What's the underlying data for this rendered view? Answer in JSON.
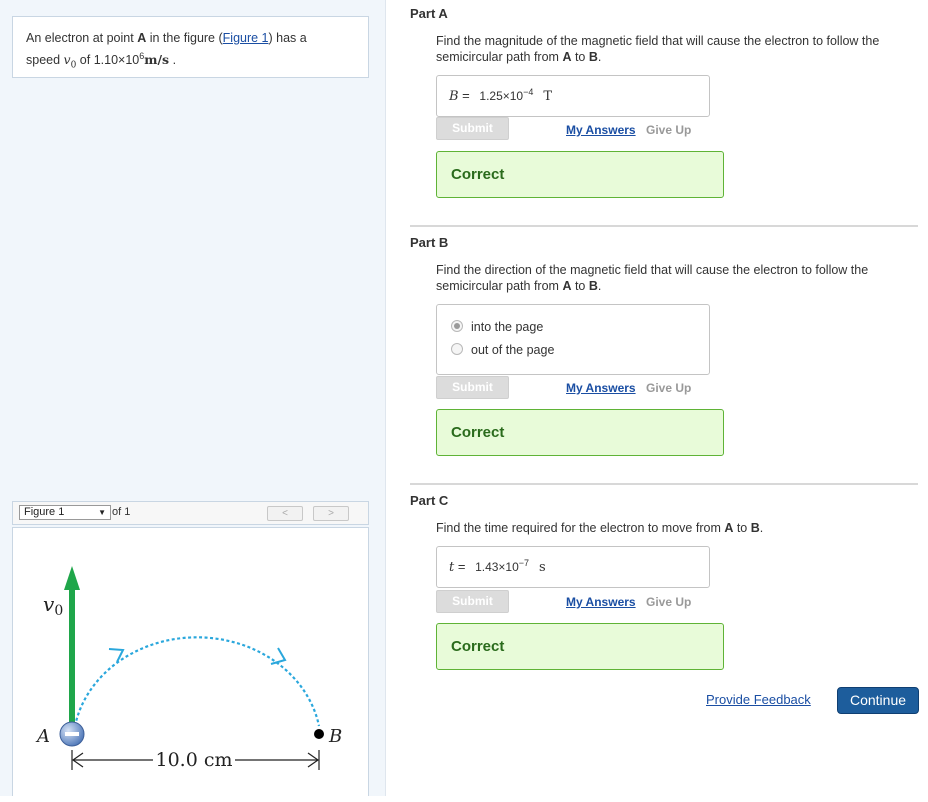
{
  "problem": {
    "text_before": "An electron at point ",
    "point_a": "A",
    "text_mid": " in the figure (",
    "figure_link": "Figure 1",
    "text_after": ") has a",
    "speed_label": "speed ",
    "v_symbol": "v",
    "v_sub": "0",
    "of_text": " of 1.10×10",
    "exp": "6",
    "units": "m/s",
    "period": " ."
  },
  "figure_nav": {
    "select_value": "Figure 1",
    "of_text": "of 1",
    "prev": "<",
    "next": ">"
  },
  "figure": {
    "v_label": "v",
    "v_sub": "0",
    "a_label": "A",
    "b_label": "B",
    "distance": "10.0 cm",
    "colors": {
      "velocity": "#1fa64a",
      "path": "#2aa7dc",
      "electron": "#5b84c4"
    }
  },
  "parts": {
    "a": {
      "title": "Part A",
      "q1": "Find the magnitude of the magnetic field that will cause the electron to follow the",
      "q2_pre": "semicircular path from ",
      "q2_a": "A",
      "q2_mid": " to ",
      "q2_b": "B",
      "q2_end": ".",
      "var": "B",
      "eq": " = ",
      "val_base": "1.25×10",
      "val_exp": "−4",
      "unit": "T",
      "submit": "Submit",
      "my_answers": "My Answers",
      "give_up": "Give Up",
      "result": "Correct"
    },
    "b": {
      "title": "Part B",
      "q1": "Find the direction of the magnetic field that will cause the electron to follow the",
      "q2_pre": "semicircular path from ",
      "q2_a": "A",
      "q2_mid": " to ",
      "q2_b": "B",
      "q2_end": ".",
      "options": [
        "into the page",
        "out of the page"
      ],
      "selected": "into the page",
      "submit": "Submit",
      "my_answers": "My Answers",
      "give_up": "Give Up",
      "result": "Correct"
    },
    "c": {
      "title": "Part C",
      "q_pre": "Find the time required for the electron to move from ",
      "q_a": "A",
      "q_mid": " to ",
      "q_b": "B",
      "q_end": ".",
      "var": "t",
      "eq": " = ",
      "val_base": "1.43×10",
      "val_exp": "−7",
      "unit": "s",
      "submit": "Submit",
      "my_answers": "My Answers",
      "give_up": "Give Up",
      "result": "Correct"
    }
  },
  "footer": {
    "feedback": "Provide Feedback",
    "continue": "Continue"
  }
}
